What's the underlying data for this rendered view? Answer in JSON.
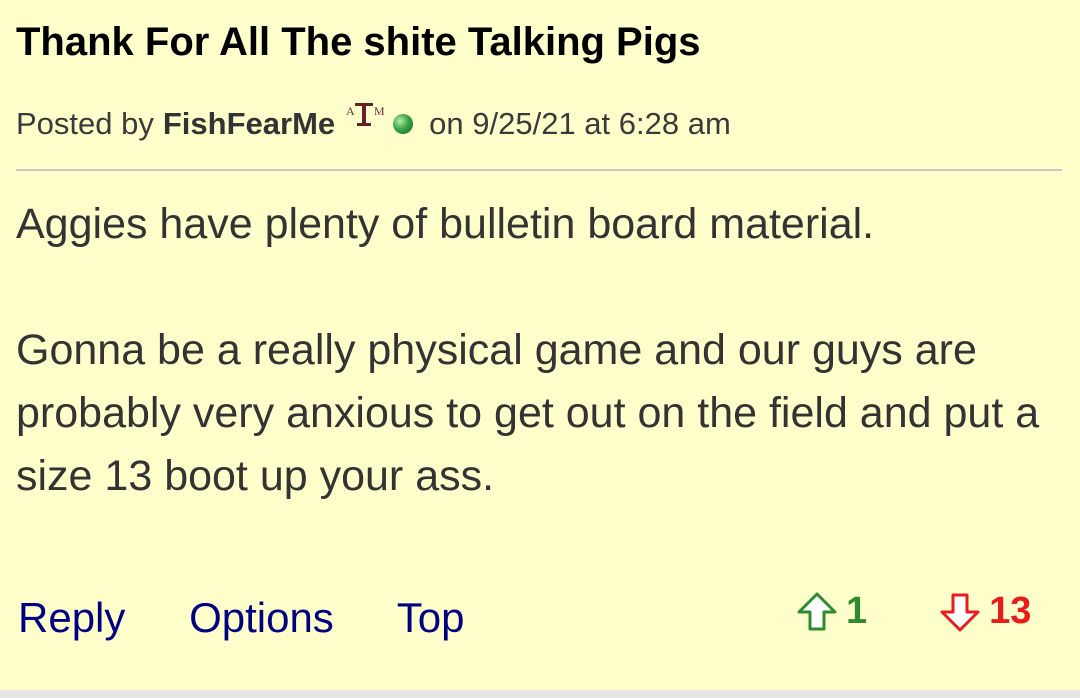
{
  "post": {
    "title": "Thank For All The shite Talking Pigs",
    "posted_by_label": "Posted by",
    "author": "FishFearMe",
    "team_logo_text": "ATM",
    "date_text": "on 9/25/21 at 6:28 am",
    "body_paragraphs": [
      "Aggies have plenty of bulletin board material.",
      "Gonna be a really physical game and our guys are probably very anxious to get out on the field and put a size 13 boot up your ass."
    ]
  },
  "actions": {
    "reply": "Reply",
    "options": "Options",
    "top": "Top"
  },
  "votes": {
    "up_count": "1",
    "down_count": "13",
    "up_color": "#2e8b2e",
    "down_color": "#e81c1c"
  },
  "colors": {
    "background": "#ffffcc",
    "link": "#000080",
    "logo_maroon": "#6b1f2a"
  }
}
